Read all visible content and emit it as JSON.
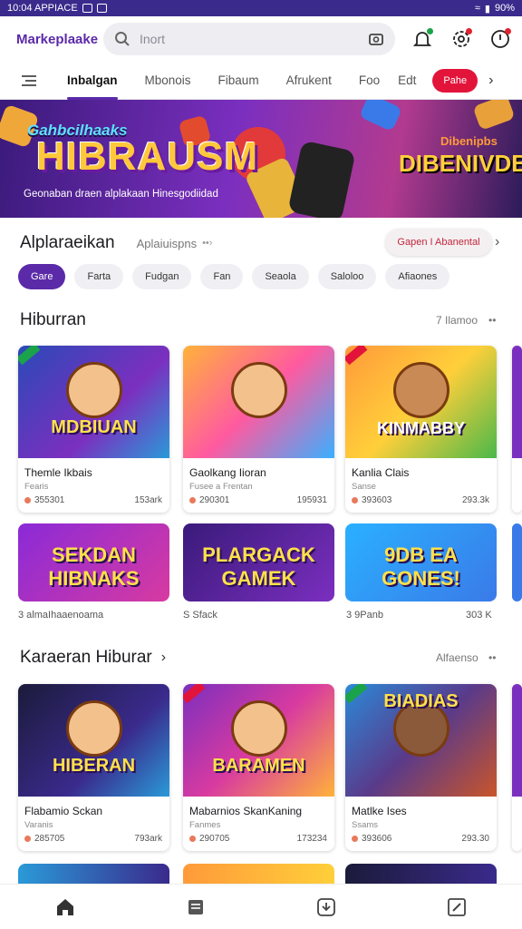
{
  "status": {
    "time": "10:04 APPIACE",
    "battery": "90%"
  },
  "header": {
    "brand": "Markeplaake",
    "search_placeholder": "Inort"
  },
  "tabs": [
    "Inbalgan",
    "Mbonois",
    "Fibaum",
    "Afrukent",
    "Foo",
    "Edt"
  ],
  "tab_pill": "Pahe",
  "banner": {
    "subtitle": "Gahbcilhaaks",
    "title": "HIBRAUSM",
    "caption": "Geonaban draen alplakaan Hinesgodiidad",
    "right_small": "Dibenipbs",
    "right_title": "DIBENIVDB"
  },
  "section1": {
    "title": "Alplaraeikan",
    "subtitle": "Aplaiuispns",
    "action": "Gapen I Abanental"
  },
  "chips": [
    "Gare",
    "Farta",
    "Fudgan",
    "Fan",
    "Seaola",
    "Saloloo",
    "Afiaones"
  ],
  "section2": {
    "title": "Hiburran",
    "more": "7 Ilamoo"
  },
  "row1": [
    {
      "art": "MDBIUAN",
      "name": "Themle Ikbais",
      "publisher": "Fearis",
      "rating": "355301",
      "downloads": "153ark"
    },
    {
      "art": "",
      "name": "Gaolkang Iioran",
      "publisher": "Fusee a Frentan",
      "rating": "290301",
      "downloads": "195931"
    },
    {
      "art": "KINMABBY",
      "name": "Kanlia Clais",
      "publisher": "Sanse",
      "rating": "393603",
      "downloads": "293.3k"
    }
  ],
  "tiles": [
    {
      "art": "SEKDAN HIBNAKS",
      "caption": "3 almaIhaaenoama"
    },
    {
      "art": "PLARGACK GAMEK",
      "caption": "S Sfack"
    },
    {
      "art": "9DB EA GONES!",
      "caption": "3 9Panb",
      "caption_right": "303 K"
    }
  ],
  "section3": {
    "title": "Karaeran Hiburar",
    "more": "Alfaenso"
  },
  "row2": [
    {
      "art": "HIBERAN",
      "name": "Flabamio Sckan",
      "publisher": "Varanis",
      "rating": "285705",
      "downloads": "793ark"
    },
    {
      "art": "BARAMEN",
      "name": "Mabarnios SkanKaning",
      "publisher": "Fanmes",
      "rating": "290705",
      "downloads": "173234"
    },
    {
      "art": "BIADIAS",
      "name": "Matlke Ises",
      "publisher": "Ssams",
      "rating": "393606",
      "downloads": "293.30"
    }
  ],
  "colors": {
    "brand": "#5b2aa8",
    "accent_red": "#e2143a",
    "statusbar": "#3a2a8c"
  },
  "bottom_nav": [
    "home-icon",
    "library-icon",
    "download-icon",
    "edit-icon"
  ]
}
